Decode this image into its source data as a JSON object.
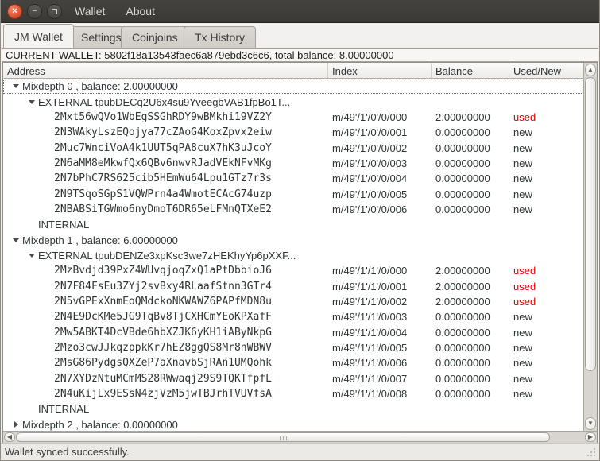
{
  "window": {
    "menu_items": [
      {
        "label": "Wallet"
      },
      {
        "label": "About"
      }
    ],
    "controls": {
      "close": "×",
      "minimize": "−",
      "maximize": ""
    }
  },
  "tabs": [
    {
      "label": "JM Wallet",
      "active": true
    },
    {
      "label": "Settings",
      "active": false
    },
    {
      "label": "Coinjoins",
      "active": false
    },
    {
      "label": "Tx History",
      "active": false
    }
  ],
  "wallet_banner": "CURRENT WALLET: 5802f18a13543faec6a879ebd3c6c6, total balance: 8.00000000",
  "table": {
    "columns": [
      "Address",
      "Index",
      "Balance",
      "Used/New"
    ],
    "rows": [
      {
        "level": 1,
        "expander": "down",
        "address": "Mixdepth 0 , balance: 2.00000000",
        "index": "",
        "balance": "",
        "status": "",
        "mono": false,
        "focused": true
      },
      {
        "level": 2,
        "expander": "down",
        "address": "EXTERNAL tpubDECq2U6x4su9YveegbVAB1fpBo1T...",
        "index": "",
        "balance": "",
        "status": "",
        "mono": false,
        "focused": false
      },
      {
        "level": 3,
        "expander": "none",
        "address": "2Mxt56wQVo1WbEgSSGhRDY9wBMkhi19VZ2Y",
        "index": "m/49'/1'/0'/0/000",
        "balance": "2.00000000",
        "status": "used",
        "mono": true,
        "focused": false
      },
      {
        "level": 3,
        "expander": "none",
        "address": "2N3WAkyLszEQojya77cZAoG4KoxZpvx2eiw",
        "index": "m/49'/1'/0'/0/001",
        "balance": "0.00000000",
        "status": "new",
        "mono": true,
        "focused": false
      },
      {
        "level": 3,
        "expander": "none",
        "address": "2Muc7WnciVoA4k1UUT5qPA8cuX7hK3uJcoY",
        "index": "m/49'/1'/0'/0/002",
        "balance": "0.00000000",
        "status": "new",
        "mono": true,
        "focused": false
      },
      {
        "level": 3,
        "expander": "none",
        "address": "2N6aMM8eMkwfQx6QBv6nwvRJadVEkNFvMKg",
        "index": "m/49'/1'/0'/0/003",
        "balance": "0.00000000",
        "status": "new",
        "mono": true,
        "focused": false
      },
      {
        "level": 3,
        "expander": "none",
        "address": "2N7bPhC7RS625cib5HEmWu64Lpu1GTz7r3s",
        "index": "m/49'/1'/0'/0/004",
        "balance": "0.00000000",
        "status": "new",
        "mono": true,
        "focused": false
      },
      {
        "level": 3,
        "expander": "none",
        "address": "2N9TSqoSGpS1VQWPrn4a4WmotECAcG74uzp",
        "index": "m/49'/1'/0'/0/005",
        "balance": "0.00000000",
        "status": "new",
        "mono": true,
        "focused": false
      },
      {
        "level": 3,
        "expander": "none",
        "address": "2NBABSiTGWmo6nyDmoT6DR65eLFMnQTXeE2",
        "index": "m/49'/1'/0'/0/006",
        "balance": "0.00000000",
        "status": "new",
        "mono": true,
        "focused": false
      },
      {
        "level": 2,
        "expander": "none",
        "address": "INTERNAL",
        "index": "",
        "balance": "",
        "status": "",
        "mono": false,
        "focused": false
      },
      {
        "level": 1,
        "expander": "down",
        "address": "Mixdepth 1 , balance: 6.00000000",
        "index": "",
        "balance": "",
        "status": "",
        "mono": false,
        "focused": false
      },
      {
        "level": 2,
        "expander": "down",
        "address": "EXTERNAL tpubDENZe3xpKsc3we7zHEKhyYp6pXXF...",
        "index": "",
        "balance": "",
        "status": "",
        "mono": false,
        "focused": false
      },
      {
        "level": 3,
        "expander": "none",
        "address": "2MzBvdjd39PxZ4WUvqjoqZxQ1aPtDbbioJ6",
        "index": "m/49'/1'/1'/0/000",
        "balance": "2.00000000",
        "status": "used",
        "mono": true,
        "focused": false
      },
      {
        "level": 3,
        "expander": "none",
        "address": "2N7F84FsEu3ZYj2svBxy4RLaafStnn3GTr4",
        "index": "m/49'/1'/1'/0/001",
        "balance": "2.00000000",
        "status": "used",
        "mono": true,
        "focused": false
      },
      {
        "level": 3,
        "expander": "none",
        "address": "2N5vGPExXnmEoQMdckoNKWAWZ6PAPfMDN8u",
        "index": "m/49'/1'/1'/0/002",
        "balance": "2.00000000",
        "status": "used",
        "mono": true,
        "focused": false
      },
      {
        "level": 3,
        "expander": "none",
        "address": "2N4E9DcKMe5JG9TqBv8TjCXHCmYEoKPXafF",
        "index": "m/49'/1'/1'/0/003",
        "balance": "0.00000000",
        "status": "new",
        "mono": true,
        "focused": false
      },
      {
        "level": 3,
        "expander": "none",
        "address": "2Mw5ABKT4DcVBde6hbXZJK6yKH1iAByNkpG",
        "index": "m/49'/1'/1'/0/004",
        "balance": "0.00000000",
        "status": "new",
        "mono": true,
        "focused": false
      },
      {
        "level": 3,
        "expander": "none",
        "address": "2Mzo3cwJJkqzppkKr7hEZ8ggQS8Mr8nWBWV",
        "index": "m/49'/1'/1'/0/005",
        "balance": "0.00000000",
        "status": "new",
        "mono": true,
        "focused": false
      },
      {
        "level": 3,
        "expander": "none",
        "address": "2MsG86PydgsQXZeP7aXnavbSjRAn1UMQohk",
        "index": "m/49'/1'/1'/0/006",
        "balance": "0.00000000",
        "status": "new",
        "mono": true,
        "focused": false
      },
      {
        "level": 3,
        "expander": "none",
        "address": "2N7XYDzNtuMCmMS28RWwaqj29S9TQKTfpfL",
        "index": "m/49'/1'/1'/0/007",
        "balance": "0.00000000",
        "status": "new",
        "mono": true,
        "focused": false
      },
      {
        "level": 3,
        "expander": "none",
        "address": "2N4uKijLx9ESsN4zjVzM5jwTBJrhTVUVfsA",
        "index": "m/49'/1'/1'/0/008",
        "balance": "0.00000000",
        "status": "new",
        "mono": true,
        "focused": false
      },
      {
        "level": 2,
        "expander": "none",
        "address": "INTERNAL",
        "index": "",
        "balance": "",
        "status": "",
        "mono": false,
        "focused": false
      },
      {
        "level": 1,
        "expander": "right",
        "address": "Mixdepth 2 , balance: 0.00000000",
        "index": "",
        "balance": "",
        "status": "",
        "mono": false,
        "focused": false
      }
    ]
  },
  "status_bar": "Wallet synced successfully.",
  "colors": {
    "used_text": "#e60000",
    "new_text": "#2e3436",
    "titlebar_bg": "#3c3a36",
    "close_button": "#dc4b2d",
    "tree_bg": "#ffffff"
  }
}
